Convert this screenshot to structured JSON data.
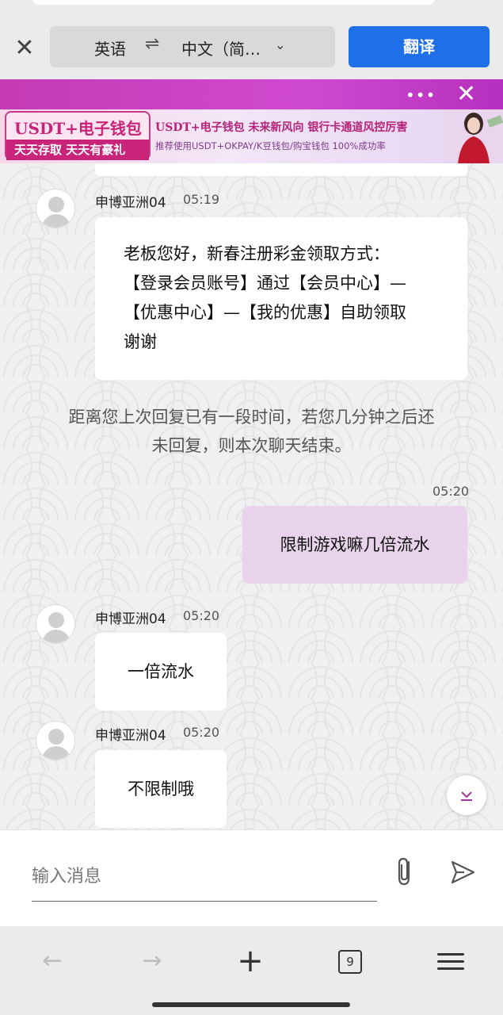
{
  "translate_bar": {
    "source_lang": "英语",
    "swap_icon": "⇌",
    "target_lang": "中文（简…",
    "chevron": "⌄",
    "translate_button": "翻译",
    "close": "✕"
  },
  "ad": {
    "dots": "•••",
    "close": "✕",
    "left_line1": "USDT+电子钱包",
    "left_line2": "天天存取 天天有豪礼",
    "headline": "USDT+电子钱包  未来新风向  银行卡通道风控厉害",
    "subline": "推荐使用USDT+OKPAY/K豆钱包/购宝钱包  100%成功率"
  },
  "messages": {
    "m1": {
      "sender": "申博亚洲04",
      "time": "05:19",
      "lines": [
        "老板您好，新春注册彩金领取方式：",
        "【登录会员账号】通过【会员中心】—",
        "【优惠中心】—【我的优惠】自助领取",
        "谢谢"
      ]
    },
    "system": [
      "距离您上次回复已有一段时间，若您几分钟之后还",
      "未回复，则本次聊天结束。"
    ],
    "m2": {
      "time": "05:20",
      "text": "限制游戏嘛几倍流水"
    },
    "m3": {
      "sender": "申博亚洲04",
      "time": "05:20",
      "text": "一倍流水"
    },
    "m4": {
      "sender": "申博亚洲04",
      "time": "05:20",
      "text": "不限制哦"
    }
  },
  "input": {
    "placeholder": "输入消息"
  },
  "nav": {
    "back": "←",
    "forward": "→",
    "new_tab": "+",
    "tab_count": "9"
  },
  "colors": {
    "accent_blue": "#1f6fe8",
    "ad_purple": "#c53ab4",
    "my_bubble": "#e9d3ec"
  }
}
